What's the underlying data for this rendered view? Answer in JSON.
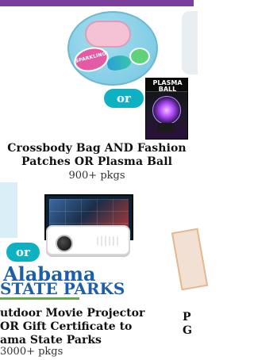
{
  "items": {
    "first": {
      "title": "Crossbody Bag AND Fashion Patches OR Plasma Ball",
      "title_lines": [
        "Crossbody Bag AND Fashion",
        "Patches OR Plasma Ball"
      ],
      "count": "900+ pkgs",
      "or_label": "or",
      "patch_text": "SPARKLING!",
      "plasma_box_label": "PLASMA BALL"
    },
    "second": {
      "title_lines": [
        "utdoor Movie Projector",
        "OR Gift Certificate to",
        "ama State Parks"
      ],
      "count": "3000+ pkgs",
      "or_label": "or",
      "logo_line1": "Alabama",
      "logo_line2": "STATE PARKS"
    },
    "right_partial": {
      "lines": [
        "P",
        "G"
      ]
    }
  },
  "colors": {
    "accent_teal": "#0eb1c1",
    "top_band": "#7a3f9d",
    "state_parks_blue": "#1d5ea8"
  },
  "icons": {
    "axolotl": "axolotl-icon",
    "hummingbird": "hummingbird-icon",
    "frog": "frog-icon"
  }
}
